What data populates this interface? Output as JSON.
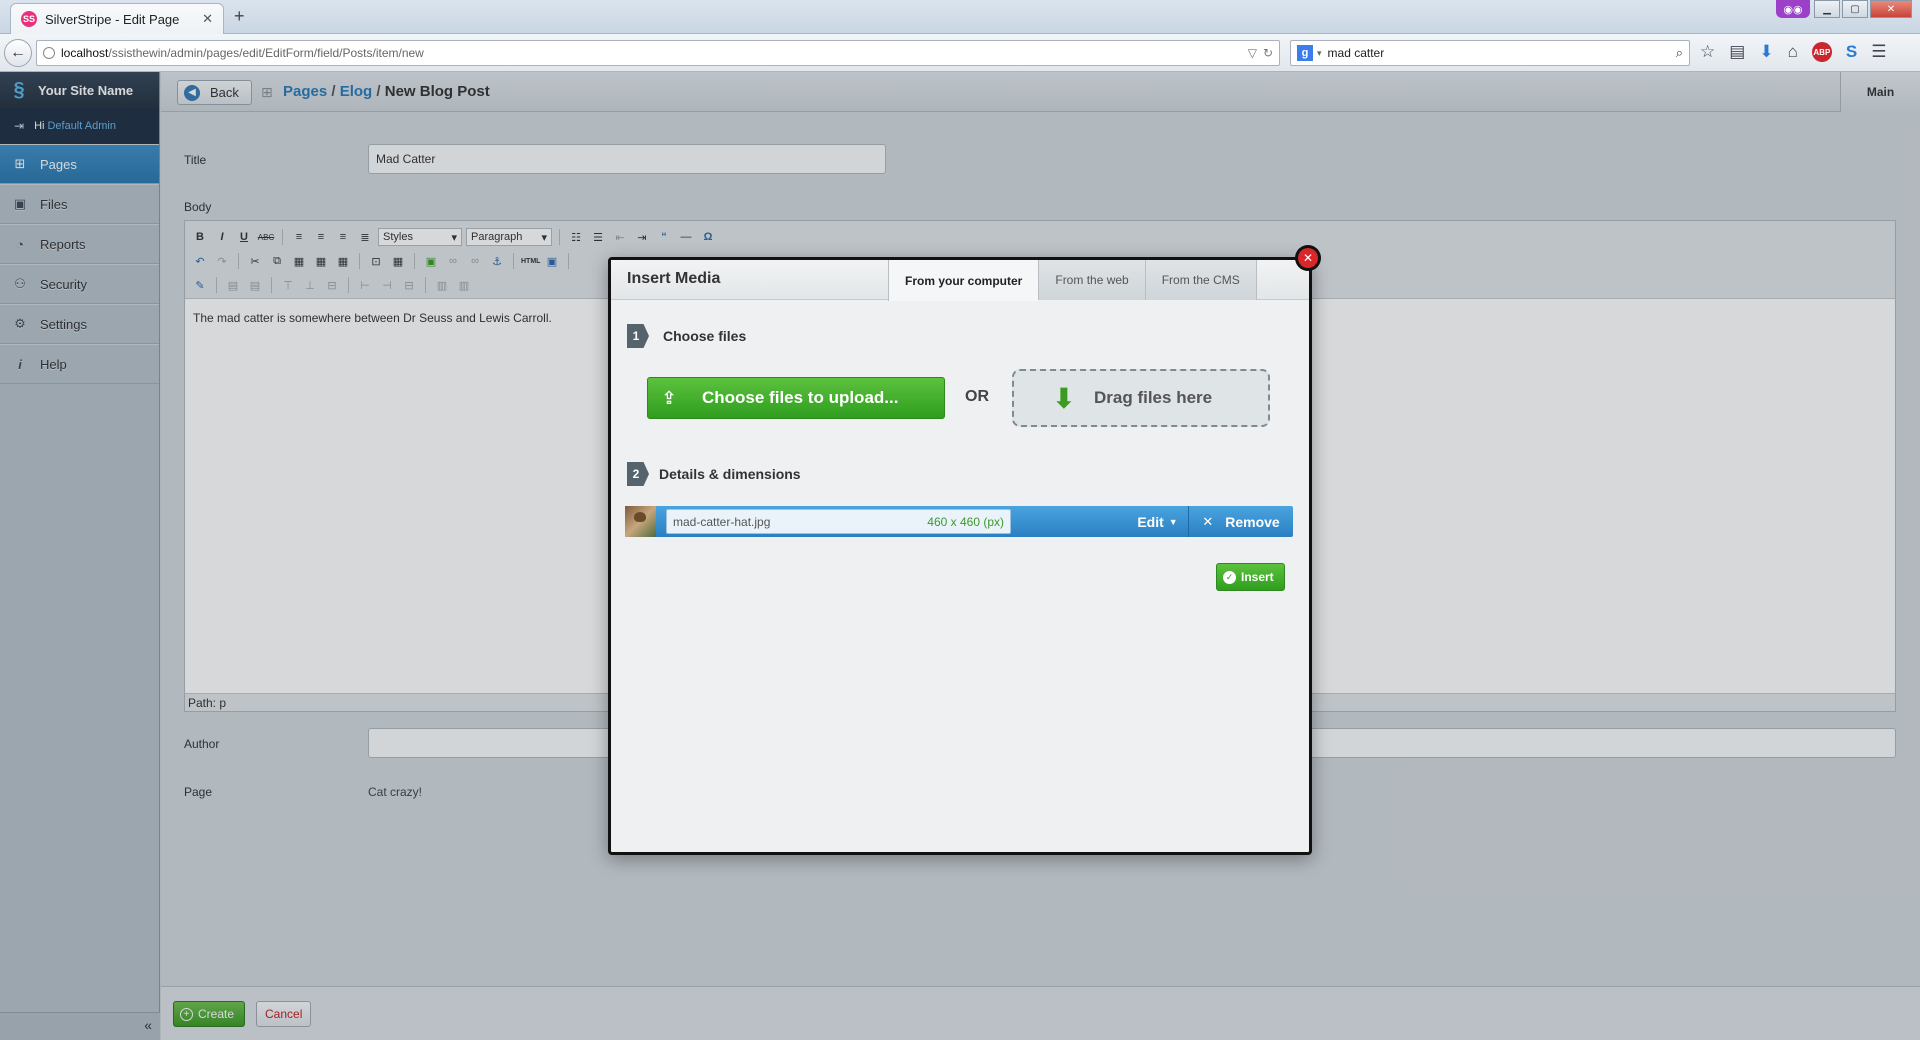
{
  "browser": {
    "tab_title": "SilverStripe - Edit Page",
    "tab_favicon": "SS",
    "new_tab": "+",
    "url_host": "localhost",
    "url_path": "/ssisthewin/admin/pages/edit/EditForm/field/Posts/item/new",
    "search_value": "mad catter",
    "search_engine_icon": "g",
    "abp_label": "ABP"
  },
  "cms": {
    "site_name": "Your Site Name",
    "greeting": "Hi",
    "user_name": "Default Admin",
    "menu": [
      {
        "label": "Pages",
        "icon": "sitemap-icon",
        "active": true
      },
      {
        "label": "Files",
        "icon": "image-icon",
        "active": false
      },
      {
        "label": "Reports",
        "icon": "chart-icon",
        "active": false
      },
      {
        "label": "Security",
        "icon": "users-icon",
        "active": false
      },
      {
        "label": "Settings",
        "icon": "wrench-icon",
        "active": false
      },
      {
        "label": "Help",
        "icon": "info-icon",
        "active": false
      }
    ],
    "collapse_label": "«"
  },
  "editor": {
    "back_label": "Back",
    "breadcrumbs": {
      "pages": "Pages",
      "sep": " / ",
      "elog": "Elog",
      "current": "New Blog Post"
    },
    "main_tab": "Main",
    "title_label": "Title",
    "title_value": "Mad Catter",
    "body_label": "Body",
    "styles_select": "Styles",
    "format_select": "Paragraph",
    "body_text": "The mad catter is somewhere between Dr Seuss and Lewis Carroll.",
    "path_text": "Path: p",
    "author_label": "Author",
    "author_value": "",
    "page_label": "Page",
    "page_value": "Cat crazy!",
    "create_label": "Create",
    "cancel_label": "Cancel"
  },
  "dialog": {
    "title": "Insert Media",
    "tabs": [
      "From your computer",
      "From the web",
      "From the CMS"
    ],
    "active_tab": 0,
    "step1_num": "1",
    "step1_label": "Choose files",
    "upload_label": "Choose files to upload...",
    "or_label": "OR",
    "drop_label": "Drag files here",
    "step2_num": "2",
    "step2_label": "Details & dimensions",
    "file_name": "mad-catter-hat.jpg",
    "file_dims": "460 x 460 (px)",
    "edit_label": "Edit",
    "remove_label": "Remove",
    "insert_label": "Insert"
  },
  "colors": {
    "accent_blue": "#2b77ad",
    "create_green": "#3d9a26",
    "cancel_red": "#c0201f",
    "close_red": "#d9262b"
  }
}
